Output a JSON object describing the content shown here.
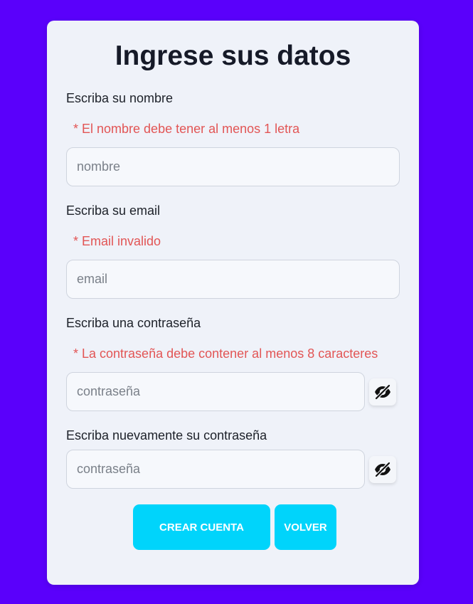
{
  "form": {
    "title": "Ingrese sus datos",
    "name": {
      "label": "Escriba su nombre",
      "error": "* El nombre debe tener al menos 1 letra",
      "placeholder": "nombre"
    },
    "email": {
      "label": "Escriba su email",
      "error": "* Email invalido",
      "placeholder": "email"
    },
    "password": {
      "label": "Escriba una contraseña",
      "error": "* La contraseña debe contener al menos 8 caracteres",
      "placeholder": "contraseña",
      "toggle_icon": "eye-slash-icon"
    },
    "password_confirm": {
      "label": "Escriba nuevamente su contraseña",
      "placeholder": "contraseña",
      "toggle_icon": "eye-slash-icon"
    },
    "buttons": {
      "create_label": "CREAR CUENTA",
      "back_label": "VOLVER"
    }
  },
  "colors": {
    "background": "#5a00fb",
    "card": "#eff2f9",
    "error": "#e25555",
    "button": "#00d4fb"
  }
}
